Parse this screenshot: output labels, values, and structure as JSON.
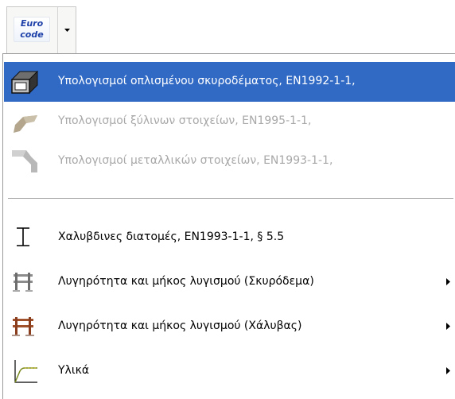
{
  "toolbar": {
    "logo_line1": "Euro",
    "logo_line2": "code",
    "dropdown_icon": "triangle-down-icon"
  },
  "menu": {
    "items": [
      {
        "label": "Υπολογισμοί οπλισμένου σκυροδέματος,  EN1992-1-1,",
        "icon": "concrete-beam-icon",
        "state": "selected"
      },
      {
        "label": "Υπολογισμοί ξύλινων στοιχείων,  EN1995-1-1,",
        "icon": "timber-beam-icon",
        "state": "disabled"
      },
      {
        "label": "Υπολογισμοί μεταλλικών στοιχείων,  EN1993-1-1,",
        "icon": "steel-beam-icon",
        "state": "disabled"
      },
      {
        "label": "Χαλυβδινες διατομές,  EN1993-1-1, § 5.5",
        "icon": "i-beam-icon",
        "state": "normal"
      },
      {
        "label": "Λυγηρότητα και μήκος λυγισμού (Σκυρόδεμα)",
        "icon": "concrete-frame-icon",
        "state": "normal",
        "submenu": true
      },
      {
        "label": "Λυγηρότητα και μήκος λυγισμού (Χάλυβας)",
        "icon": "steel-frame-icon",
        "state": "normal",
        "submenu": true
      },
      {
        "label": "Υλικά",
        "icon": "stress-strain-icon",
        "state": "normal",
        "submenu": true
      }
    ]
  },
  "colors": {
    "selection": "#316ac5",
    "disabled_text": "#a8a8a8",
    "logo_text": "#1c3fa8",
    "steel_frame": "#a0522d"
  }
}
